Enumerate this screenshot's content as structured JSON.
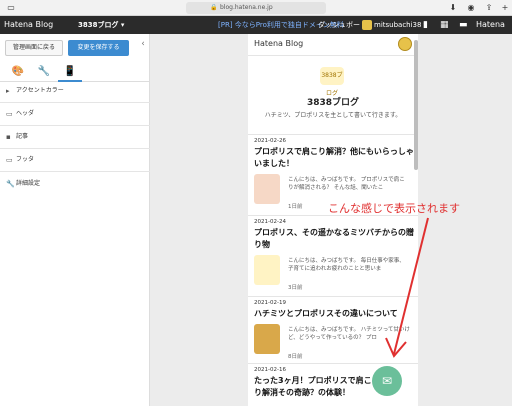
{
  "browser": {
    "url": "blog.hatena.ne.jp",
    "lock_icon": "lock-icon",
    "download_icon": "download-icon",
    "shield_icon": "shield-icon",
    "share_icon": "share-icon"
  },
  "hatena_bar": {
    "logo": "Hatena Blog",
    "blog_menu": "3838ブログ ▾",
    "promo": "[PR] 今ならPro利用で独自ドメイン無料",
    "dashboard": "ダッシュボード",
    "user": "mitsubachi38 ▾",
    "brand": "Hatena"
  },
  "sidebar": {
    "back_button": "管理画面に戻る",
    "save_button": "変更を保存する",
    "collapse_glyph": "‹",
    "tabs": [
      {
        "icon": "palette-icon",
        "glyph": "🎨"
      },
      {
        "icon": "wrench-icon",
        "glyph": "🔧"
      },
      {
        "icon": "smartphone-icon",
        "glyph": "📱"
      }
    ],
    "items": [
      {
        "label": "アクセントカラー",
        "glyph": "▸"
      },
      {
        "label": "ヘッダ",
        "glyph": "▭"
      },
      {
        "label": "記事",
        "glyph": "▪"
      },
      {
        "label": "フッタ",
        "glyph": "▭"
      },
      {
        "label": "詳細設定",
        "glyph": "🔧"
      }
    ]
  },
  "preview": {
    "logo": "Hatena Blog",
    "blog_icon_text": "3838ブログ",
    "blog_title": "3838ブログ",
    "blog_description": "ハチミツ、プロポリスを主として書いて行きます。",
    "posts": [
      {
        "date": "2021-02-26",
        "title": "プロポリスで肩こり解消？他にもいらっしゃいました！",
        "excerpt": "こんにちは、みつばちです。 プロポリスで肩こりが解消される？ そんな話、聞いたこ",
        "ago": "1日前",
        "thumb_color": "#f6d8c6"
      },
      {
        "date": "2021-02-24",
        "title": "プロポリス、その遥かなるミツバチからの贈り物",
        "excerpt": "こんにちは、みつばちです。 毎日仕事や家事、子育てに追われお疲れのことと思いま",
        "ago": "3日前",
        "thumb_color": "#fff3c4"
      },
      {
        "date": "2021-02-19",
        "title": "ハチミツとプロポリスその違いについて",
        "excerpt": "こんにちは、みつばちです。 ハチミツって甘いけど、どうやって作っているの？ プロ",
        "ago": "8日前",
        "thumb_color": "#d9a84a"
      },
      {
        "date": "2021-02-16",
        "title": "たった3ヶ月！プロポリスで肩こり解消その奇跡？の体験！",
        "excerpt": "",
        "ago": "",
        "thumb_color": ""
      }
    ]
  },
  "annotation": "こんな感じで表示されます",
  "fab_icon": "mail-icon",
  "colors": {
    "accent_blue": "#3c8bd0",
    "annotation_red": "#e03030",
    "fab_green": "#6bbf9a"
  }
}
